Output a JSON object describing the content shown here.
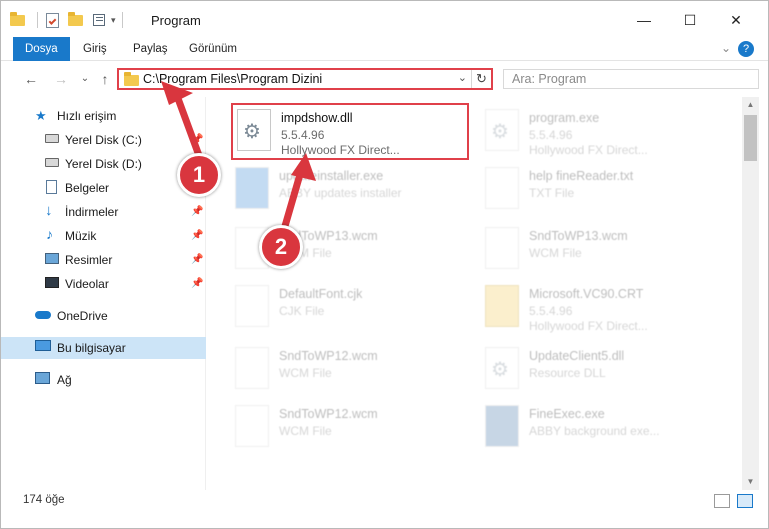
{
  "window": {
    "title": "Program",
    "minimize": "—",
    "maximize": "☐",
    "close": "✕"
  },
  "ribbon": {
    "tabs": [
      "Dosya",
      "Giriş",
      "Paylaş",
      "Görünüm"
    ],
    "expand_glyph": "⌄",
    "help_glyph": "?"
  },
  "nav": {
    "back": "←",
    "forward": "→",
    "recent": "⌄",
    "up": "↑"
  },
  "address": {
    "path": "C:\\Program Files\\Program Dizini",
    "dropdown": "⌄",
    "refresh": "↻"
  },
  "search": {
    "placeholder": "Ara: Program"
  },
  "sidebar": {
    "items": [
      {
        "label": "Hızlı erişim",
        "icon": "star-icon",
        "pinned": false
      },
      {
        "label": "Yerel Disk (C:)",
        "icon": "drive-icon",
        "pinned": true
      },
      {
        "label": "Yerel Disk (D:)",
        "icon": "drive-icon",
        "pinned": true
      },
      {
        "label": "Belgeler",
        "icon": "documents-icon",
        "pinned": true
      },
      {
        "label": "İndirmeler",
        "icon": "download-icon",
        "pinned": true
      },
      {
        "label": "Müzik",
        "icon": "music-icon",
        "pinned": true
      },
      {
        "label": "Resimler",
        "icon": "pictures-icon",
        "pinned": true
      },
      {
        "label": "Videolar",
        "icon": "videos-icon",
        "pinned": true
      },
      {
        "label": "OneDrive",
        "icon": "cloud-icon",
        "pinned": false
      },
      {
        "label": "Bu bilgisayar",
        "icon": "computer-icon",
        "pinned": false
      },
      {
        "label": "Ağ",
        "icon": "network-icon",
        "pinned": false
      }
    ],
    "pin_glyph": "📌"
  },
  "files": [
    {
      "name": "impdshow.dll",
      "line2": "5.5.4.96",
      "line3": "Hollywood FX Direct...",
      "highlight": true
    },
    {
      "name": "program.exe",
      "line2": "5.5.4.96",
      "line3": "Hollywood FX Direct..."
    },
    {
      "name": "updateinstaller.exe",
      "line2": "ABBY updates installer",
      "line3": ""
    },
    {
      "name": "help fineReader.txt",
      "line2": "TXT File",
      "line3": ""
    },
    {
      "name": "SndToWP13.wcm",
      "line2": "WCM File",
      "line3": ""
    },
    {
      "name": "SndToWP13.wcm",
      "line2": "WCM File",
      "line3": ""
    },
    {
      "name": "DefaultFont.cjk",
      "line2": "CJK File",
      "line3": ""
    },
    {
      "name": "Microsoft.VC90.CRT",
      "line2": "5.5.4.96",
      "line3": "Hollywood FX Direct..."
    },
    {
      "name": "SndToWP12.wcm",
      "line2": "WCM File",
      "line3": ""
    },
    {
      "name": "UpdateClient5.dll",
      "line2": "Resource DLL",
      "line3": ""
    },
    {
      "name": "SndToWP12.wcm",
      "line2": "WCM File",
      "line3": ""
    },
    {
      "name": "FineExec.exe",
      "line2": "ABBY background exe...",
      "line3": ""
    }
  ],
  "status": {
    "count": "174 öğe"
  },
  "callouts": [
    "1",
    "2"
  ],
  "colors": {
    "accent": "#1979ca",
    "highlight": "#e0404a",
    "callout": "#d9363e"
  }
}
